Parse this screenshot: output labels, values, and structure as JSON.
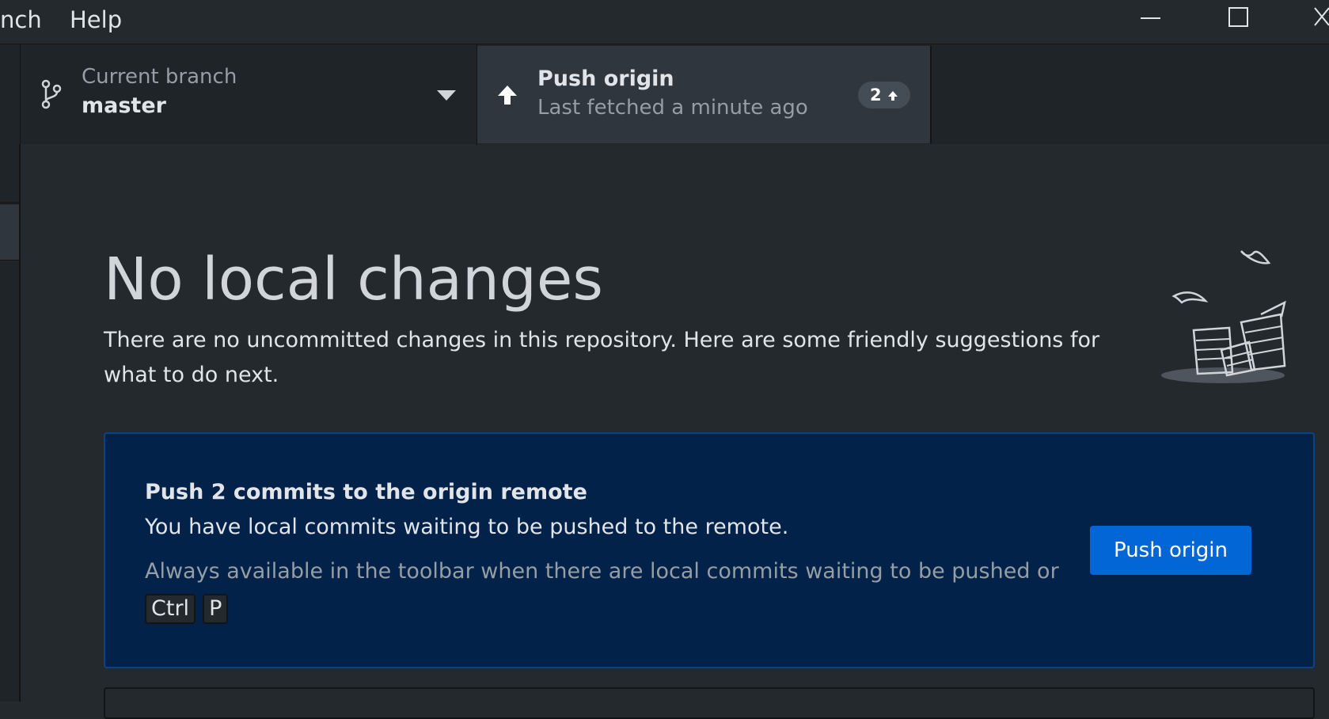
{
  "titlebar": {
    "menu": [
      "nch",
      "Help"
    ]
  },
  "toolbar": {
    "branch": {
      "label": "Current branch",
      "value": "master"
    },
    "push": {
      "title": "Push origin",
      "subtitle": "Last fetched a minute ago",
      "ahead_count": "2"
    }
  },
  "main": {
    "heading": "No local changes",
    "description": "There are no uncommitted changes in this repository. Here are some friendly suggestions for what to do next.",
    "push_card": {
      "title": "Push 2 commits to the origin remote",
      "body": "You have local commits waiting to be pushed to the remote.",
      "hint": "Always available in the toolbar when there are local commits waiting to be pushed or",
      "shortcut_keys": [
        "Ctrl",
        "P"
      ],
      "button_label": "Push origin"
    }
  },
  "colors": {
    "background": "#24292e",
    "toolbar": "#1f2428",
    "card_background": "#022249",
    "card_border": "#0b4387",
    "primary_button": "#0366d6"
  },
  "icons": [
    "branch-icon",
    "caret-down-icon",
    "arrow-up-icon",
    "minimize-icon",
    "maximize-icon",
    "close-icon"
  ]
}
